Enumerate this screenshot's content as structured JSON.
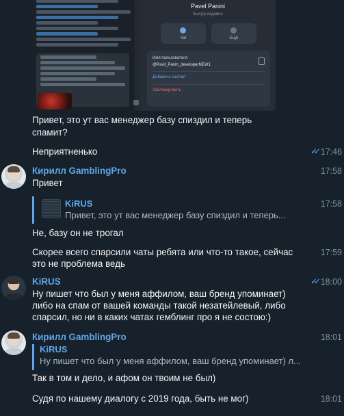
{
  "embedded_screenshot": {
    "profile_name": "Pavel Panini",
    "profile_status": "был(а) недавно",
    "button_chat": "Чат",
    "button_more": "Ещё",
    "username_label": "Имя пользователя",
    "username_value": "@Pavil_Panin_developerNEW1",
    "add_contact": "Добавить контакт",
    "block": "Заблокировать"
  },
  "messages": [
    {
      "id": "m1",
      "text_lines": [
        "Привет, это ут вас менеджер базу спиздил и теперь",
        "спамит?"
      ]
    },
    {
      "id": "m2",
      "text": "Неприятненько",
      "time": "17:46",
      "read": true
    },
    {
      "id": "m3",
      "sender": "Кирилл GamblingPro",
      "text": "Привет",
      "time": "17:58"
    },
    {
      "id": "m4",
      "reply_name": "KiRUS",
      "reply_text": "Привет, это ут вас менеджер базу спиздил и теперь...",
      "time": "17:58"
    },
    {
      "id": "m5",
      "text": "Не, базу он не трогал"
    },
    {
      "id": "m6",
      "text_lines": [
        "Скорее всего спарсили чаты ребята или что-то такое, сейчас",
        "это не проблема ведь"
      ],
      "time": "17:59"
    },
    {
      "id": "m7",
      "sender": "KiRUS",
      "time": "18:00",
      "read": true,
      "text_lines": [
        "Ну пишет что был у меня аффилом, ваш бренд упоминает)",
        "либо на спам от вашей команды такой незатейлевый, либо",
        "спарсил, но ни в каких чатах гемблинг про я не состою:)"
      ]
    },
    {
      "id": "m8",
      "sender": "Кирилл GamblingPro",
      "time": "18:01",
      "reply_name": "KiRUS",
      "reply_text": "Ну пишет что был у меня аффилом, ваш бренд упоминает) л...",
      "text": "Так в том и дело, и афом он твоим не был)"
    },
    {
      "id": "m9",
      "text": "Судя по нашему диалогу с 2019 года, быть не мог)",
      "time": "18:01"
    }
  ],
  "colors": {
    "background": "#17212b",
    "accent": "#5fa7e9",
    "text": "#f5f5f5",
    "time": "#8493a1"
  },
  "icons": {
    "read_receipt": "double-check-icon"
  }
}
